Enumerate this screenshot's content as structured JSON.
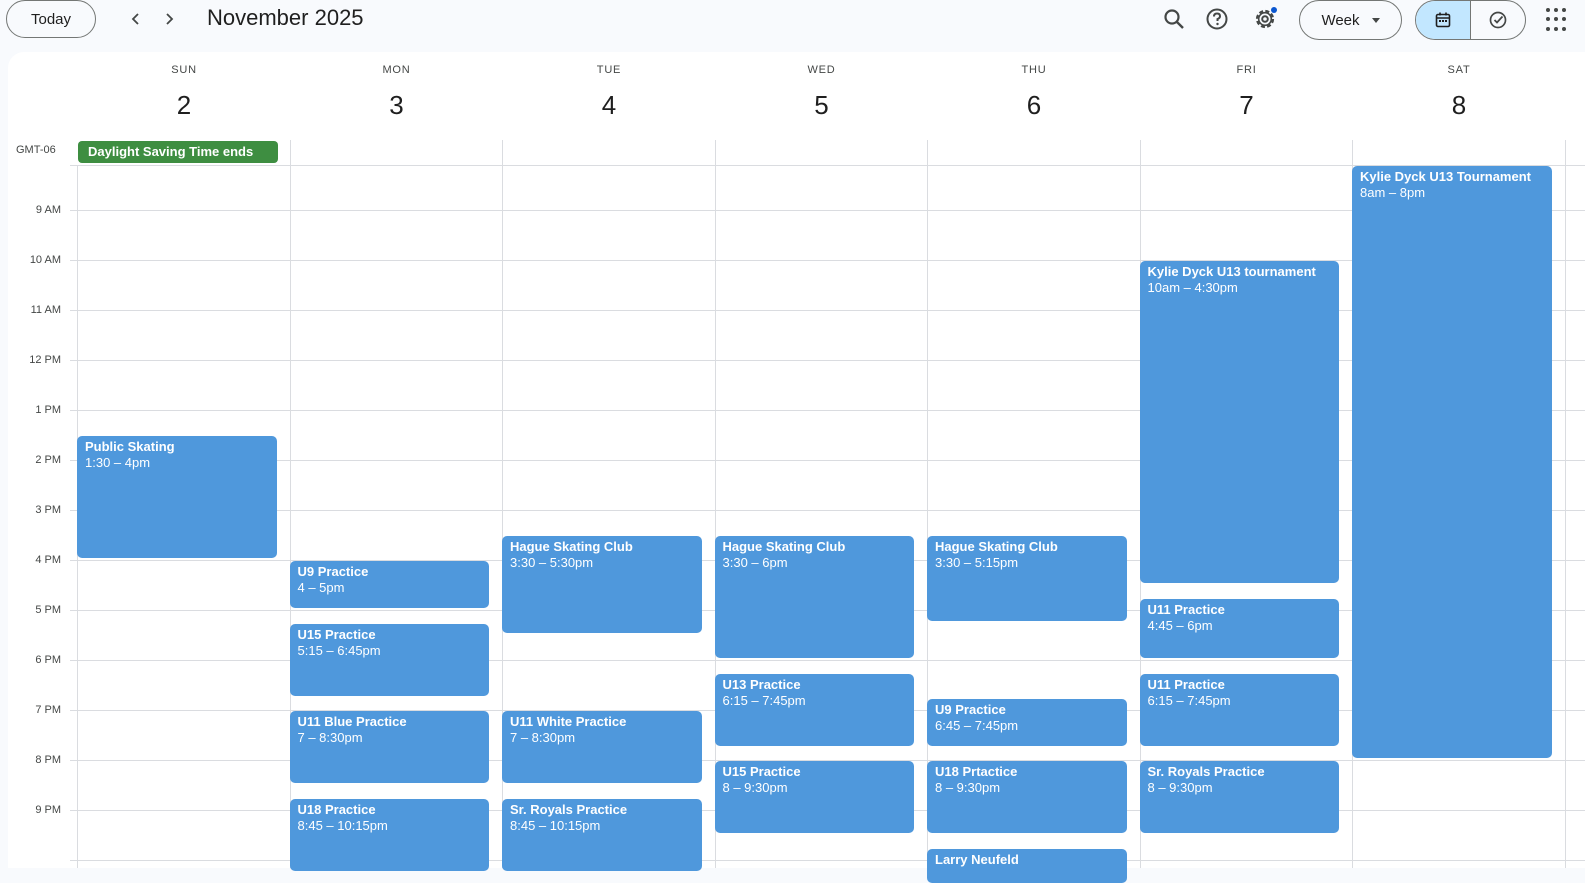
{
  "toolbar": {
    "today_label": "Today",
    "prev_icon": "chevron-left-icon",
    "next_icon": "chevron-right-icon",
    "title": "November 2025",
    "view_label": "Week"
  },
  "colors": {
    "event": "#4f98dc",
    "holiday": "#3e8e41",
    "active_toggle": "#c2e7ff"
  },
  "timezone": "GMT-06",
  "days": [
    {
      "dow": "SUN",
      "num": "2"
    },
    {
      "dow": "MON",
      "num": "3"
    },
    {
      "dow": "TUE",
      "num": "4"
    },
    {
      "dow": "WED",
      "num": "5"
    },
    {
      "dow": "THU",
      "num": "6"
    },
    {
      "dow": "FRI",
      "num": "7"
    },
    {
      "dow": "SAT",
      "num": "8"
    }
  ],
  "all_day_event": {
    "title": "Daylight Saving Time ends"
  },
  "hours": [
    "9 AM",
    "10 AM",
    "11 AM",
    "12 PM",
    "1 PM",
    "2 PM",
    "3 PM",
    "4 PM",
    "5 PM",
    "6 PM",
    "7 PM",
    "8 PM",
    "9 PM"
  ],
  "events": [
    {
      "day": 0,
      "title": "Public Skating",
      "time": "1:30 – 4pm",
      "start": 13.5,
      "end": 16.0
    },
    {
      "day": 1,
      "title": "U9 Practice",
      "time": "4 – 5pm",
      "start": 16.0,
      "end": 17.0
    },
    {
      "day": 1,
      "title": "U15 Practice",
      "time": "5:15 – 6:45pm",
      "start": 17.25,
      "end": 18.75
    },
    {
      "day": 1,
      "title": "U11 Blue Practice",
      "time": "7 – 8:30pm",
      "start": 19.0,
      "end": 20.5
    },
    {
      "day": 1,
      "title": "U18 Practice",
      "time": "8:45 – 10:15pm",
      "start": 20.75,
      "end": 22.25
    },
    {
      "day": 2,
      "title": "Hague Skating Club",
      "time": "3:30 – 5:30pm",
      "start": 15.5,
      "end": 17.5
    },
    {
      "day": 2,
      "title": "U11 White Practice",
      "time": "7 – 8:30pm",
      "start": 19.0,
      "end": 20.5
    },
    {
      "day": 2,
      "title": "Sr. Royals Practice",
      "time": "8:45 – 10:15pm",
      "start": 20.75,
      "end": 22.25
    },
    {
      "day": 3,
      "title": "Hague Skating Club",
      "time": "3:30 – 6pm",
      "start": 15.5,
      "end": 18.0
    },
    {
      "day": 3,
      "title": "U13 Practice",
      "time": "6:15 – 7:45pm",
      "start": 18.25,
      "end": 19.75
    },
    {
      "day": 3,
      "title": "U15 Practice",
      "time": "8 – 9:30pm",
      "start": 20.0,
      "end": 21.5
    },
    {
      "day": 4,
      "title": "Hague Skating Club",
      "time": "3:30 – 5:15pm",
      "start": 15.5,
      "end": 17.25
    },
    {
      "day": 4,
      "title": "U9 Practice",
      "time": "6:45 – 7:45pm",
      "start": 18.75,
      "end": 19.75
    },
    {
      "day": 4,
      "title": "U18 Prtactice",
      "time": "8 – 9:30pm",
      "start": 20.0,
      "end": 21.5
    },
    {
      "day": 4,
      "title": "Larry Neufeld",
      "time": "",
      "start": 21.75,
      "end": 22.5
    },
    {
      "day": 5,
      "title": "Kylie Dyck U13 tournament",
      "time": "10am – 4:30pm",
      "start": 10.0,
      "end": 16.5
    },
    {
      "day": 5,
      "title": "U11 Practice",
      "time": "4:45 – 6pm",
      "start": 16.75,
      "end": 18.0
    },
    {
      "day": 5,
      "title": "U11 Practice",
      "time": "6:15 – 7:45pm",
      "start": 18.25,
      "end": 19.75
    },
    {
      "day": 5,
      "title": "Sr. Royals Practice",
      "time": "8 – 9:30pm",
      "start": 20.0,
      "end": 21.5
    },
    {
      "day": 6,
      "title": "Kylie Dyck U13 Tournament",
      "time": "8am – 8pm",
      "start": 8.0,
      "end": 20.0
    }
  ]
}
